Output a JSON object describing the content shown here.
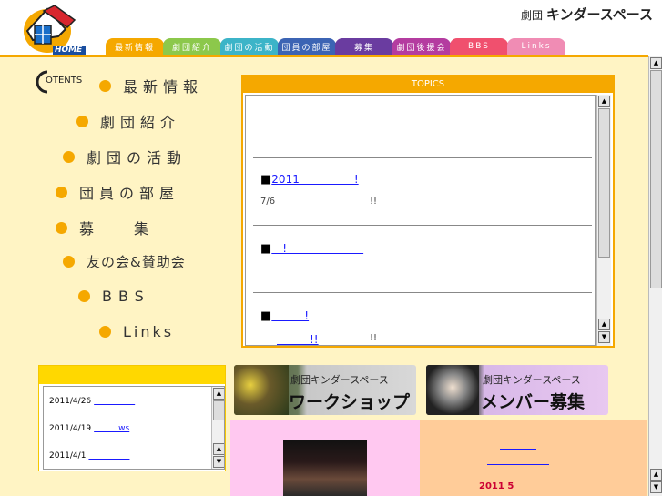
{
  "header": {
    "home_label": "HOME",
    "brand_small": "劇団",
    "brand_main": "キンダースペース"
  },
  "nav": [
    {
      "label": "最新情報",
      "color": "#f5a800"
    },
    {
      "label": "劇団紹介",
      "color": "#8cc84b"
    },
    {
      "label": "劇団の活動",
      "color": "#3cb4c8"
    },
    {
      "label": "団員の部屋",
      "color": "#3c64b4"
    },
    {
      "label": "募集",
      "color": "#6a3ca0"
    },
    {
      "label": "劇団後援会",
      "color": "#b43ca0"
    },
    {
      "label": "BBS",
      "color": "#f0506e"
    },
    {
      "label": "Links",
      "color": "#f08cb4"
    }
  ],
  "contents_logo": "OTENTS",
  "menu": [
    {
      "label": "最新情報"
    },
    {
      "label": "劇団紹介"
    },
    {
      "label": "劇団の活動"
    },
    {
      "label": "団員の部屋"
    },
    {
      "label": "募　集"
    },
    {
      "label": "友の会&賛助会"
    },
    {
      "label": "BBS"
    },
    {
      "label": "Links"
    }
  ],
  "topics": {
    "title": "TOPICS",
    "items": [
      {
        "bullet": "■",
        "link": "2011　　　　　!",
        "sub_left": "7/6",
        "sub_right": "!!"
      },
      {
        "bullet": "■",
        "link": "　!　　　　　　　",
        "sub_left": "",
        "sub_right": ""
      },
      {
        "bullet": "■",
        "link": "　　　!",
        "sub_left": "　　　!!",
        "sub_right": "!!"
      }
    ]
  },
  "news": {
    "items": [
      {
        "date": "2011/4/26",
        "link": "　　　　　"
      },
      {
        "date": "2011/4/19",
        "link": "　　　ws"
      },
      {
        "date": "2011/4/1",
        "link": "　　　　　"
      }
    ]
  },
  "banners": {
    "workshop": {
      "small": "劇団キンダースペース",
      "big": "ワークショップ"
    },
    "member": {
      "small": "劇団キンダースペース",
      "big": "メンバー募集"
    }
  },
  "peach": {
    "date": "2011 5"
  }
}
